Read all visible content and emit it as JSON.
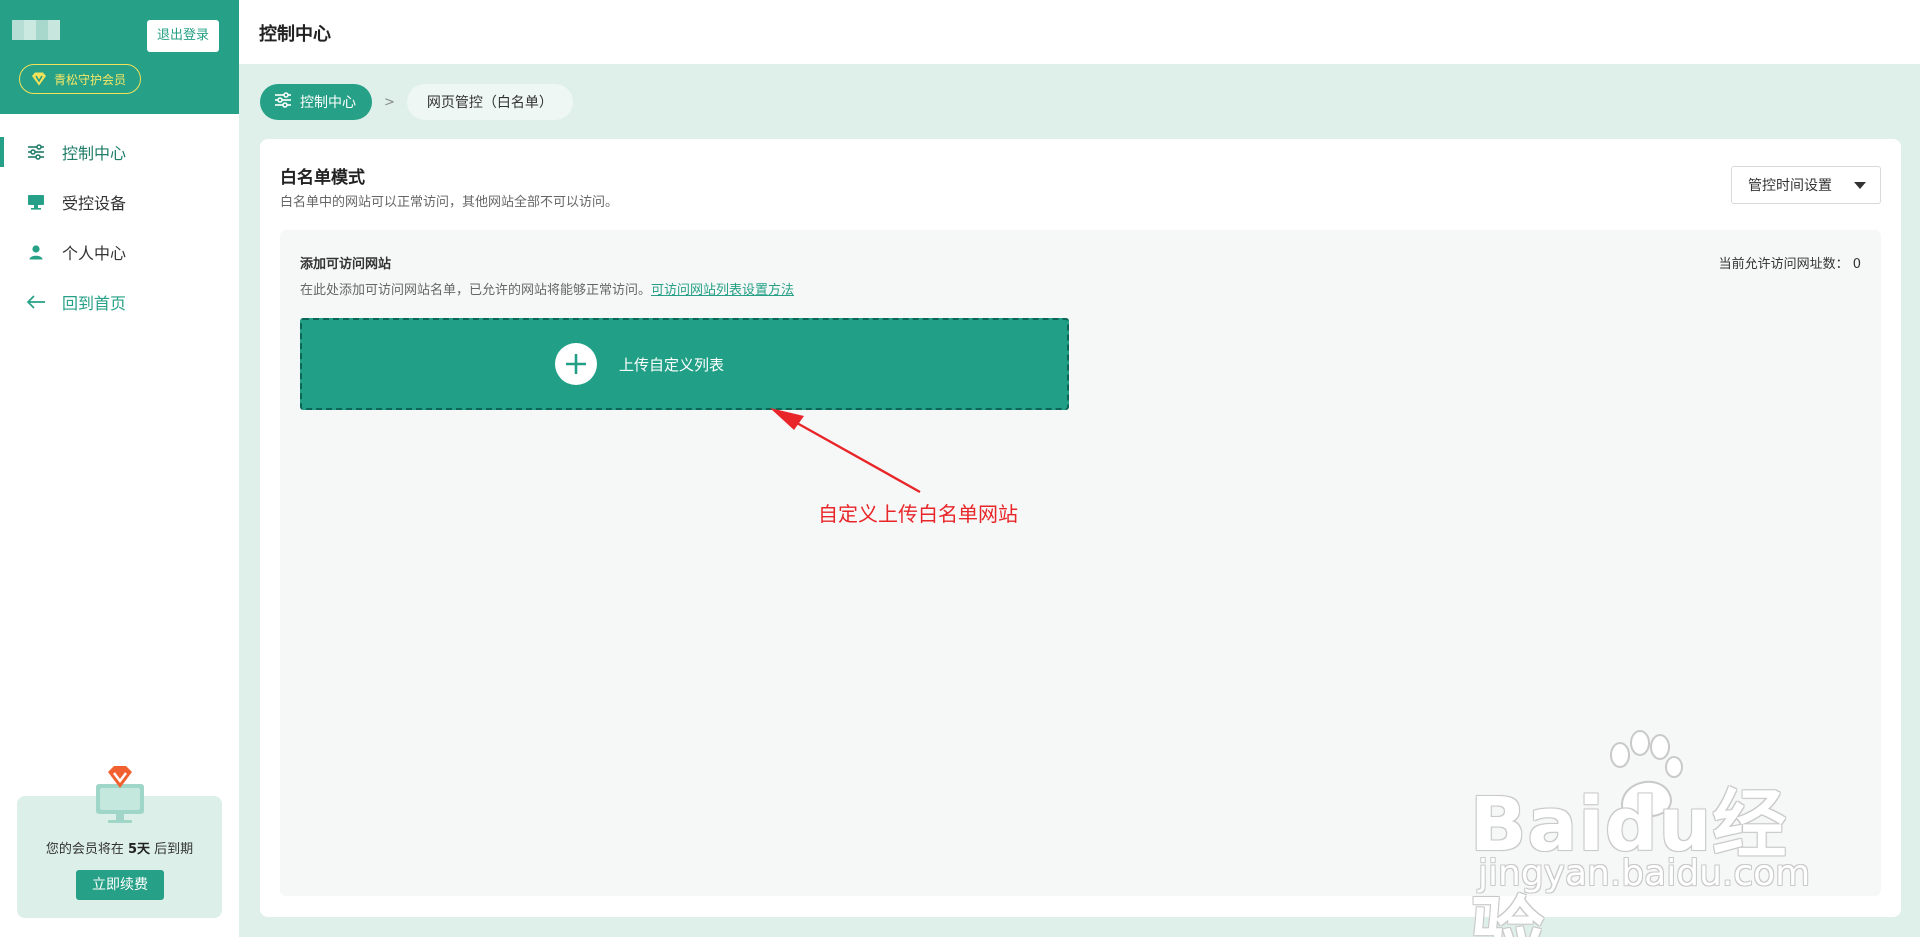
{
  "sidebar": {
    "logout_label": "退出登录",
    "member_badge": "青松守护会员",
    "items": [
      {
        "label": "控制中心",
        "icon": "sliders-icon"
      },
      {
        "label": "受控设备",
        "icon": "monitor-icon"
      },
      {
        "label": "个人中心",
        "icon": "user-icon"
      },
      {
        "label": "回到首页",
        "icon": "arrow-left-icon"
      }
    ],
    "renew": {
      "text_before": "您的会员将在 ",
      "days": "5天",
      "text_after": " 后到期",
      "button": "立即续费"
    }
  },
  "header": {
    "title": "控制中心"
  },
  "breadcrumb": {
    "main": "控制中心",
    "separator": ">",
    "current": "网页管控（白名单）"
  },
  "card": {
    "title": "白名单模式",
    "description": "白名单中的网站可以正常访问，其他网站全部不可以访问。",
    "time_select": "管控时间设置"
  },
  "panel": {
    "title": "添加可访问网站",
    "description": "在此处添加可访问网站名单，已允许的网站将能够正常访问。",
    "help_link": "可访问网站列表设置方法",
    "count_label": "当前允许访问网址数：",
    "count_value": "0",
    "upload_label": "上传自定义列表"
  },
  "annotation": {
    "text": "自定义上传白名单网站"
  },
  "watermark": {
    "brand": "Baidu经验",
    "url": "jingyan.baidu.com"
  },
  "colors": {
    "primary": "#26a086",
    "annotation": "#e8262a",
    "badge": "#f3e25a",
    "background": "#dff0eb"
  }
}
